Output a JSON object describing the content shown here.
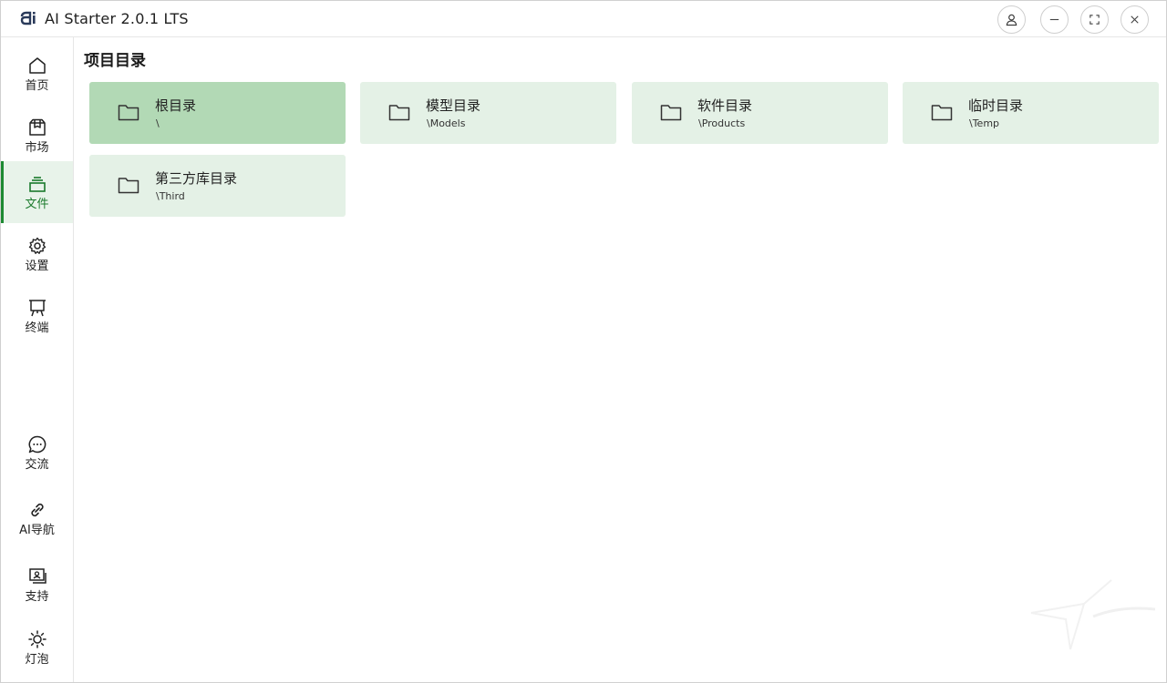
{
  "app": {
    "title": "AI Starter 2.0.1 LTS"
  },
  "titlebar": {
    "buttons": [
      "user-icon",
      "minimize-icon",
      "maximize-icon",
      "close-icon"
    ]
  },
  "sidebar": {
    "items": [
      {
        "label": "首页",
        "icon": "home-icon"
      },
      {
        "label": "市场",
        "icon": "package-icon"
      },
      {
        "label": "文件",
        "icon": "layers-icon",
        "active": true
      },
      {
        "label": "设置",
        "icon": "gear-icon"
      },
      {
        "label": "终端",
        "icon": "easel-icon"
      }
    ],
    "bottom_items": [
      {
        "label": "交流",
        "icon": "chat-icon"
      },
      {
        "label": "AI导航",
        "icon": "link-icon"
      },
      {
        "label": "支持",
        "icon": "support-icon"
      },
      {
        "label": "灯泡",
        "icon": "sun-icon"
      }
    ]
  },
  "main": {
    "title": "项目目录",
    "folders": [
      {
        "name": "根目录",
        "path": "\\",
        "selected": true
      },
      {
        "name": "模型目录",
        "path": "\\Models"
      },
      {
        "name": "软件目录",
        "path": "\\Products"
      },
      {
        "name": "临时目录",
        "path": "\\Temp"
      },
      {
        "name": "第三方库目录",
        "path": "\\Third"
      }
    ]
  },
  "colors": {
    "accent": "#1d8a32",
    "card": "#e4f1e6",
    "card_selected": "#b2d9b5"
  }
}
